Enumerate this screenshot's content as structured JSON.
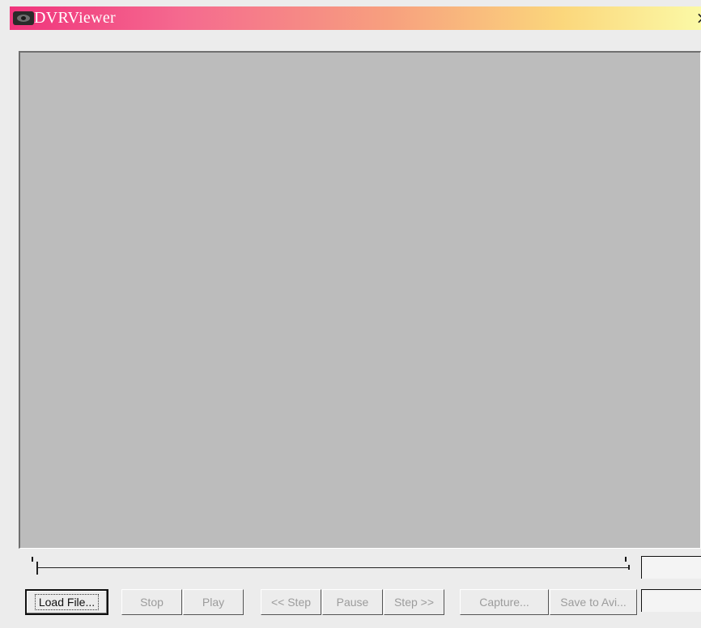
{
  "window": {
    "title": "DVRViewer",
    "icon": "eye-icon",
    "close_glyph": "×"
  },
  "video": {
    "background": "#bcbcbc"
  },
  "seekbar": {
    "position_pct": 0
  },
  "buttons": {
    "load_file": "Load File...",
    "stop": "Stop",
    "play": "Play",
    "step_back": "<< Step",
    "pause": "Pause",
    "step_forward": "Step >>",
    "capture": "Capture...",
    "save_to_avi": "Save to Avi..."
  },
  "fields": {
    "top_value": "",
    "bottom_value": ""
  },
  "colors": {
    "title_gradient_start": "#f0337c",
    "title_gradient_end": "#fbf9a6",
    "disabled_text": "#9c9c9c"
  }
}
